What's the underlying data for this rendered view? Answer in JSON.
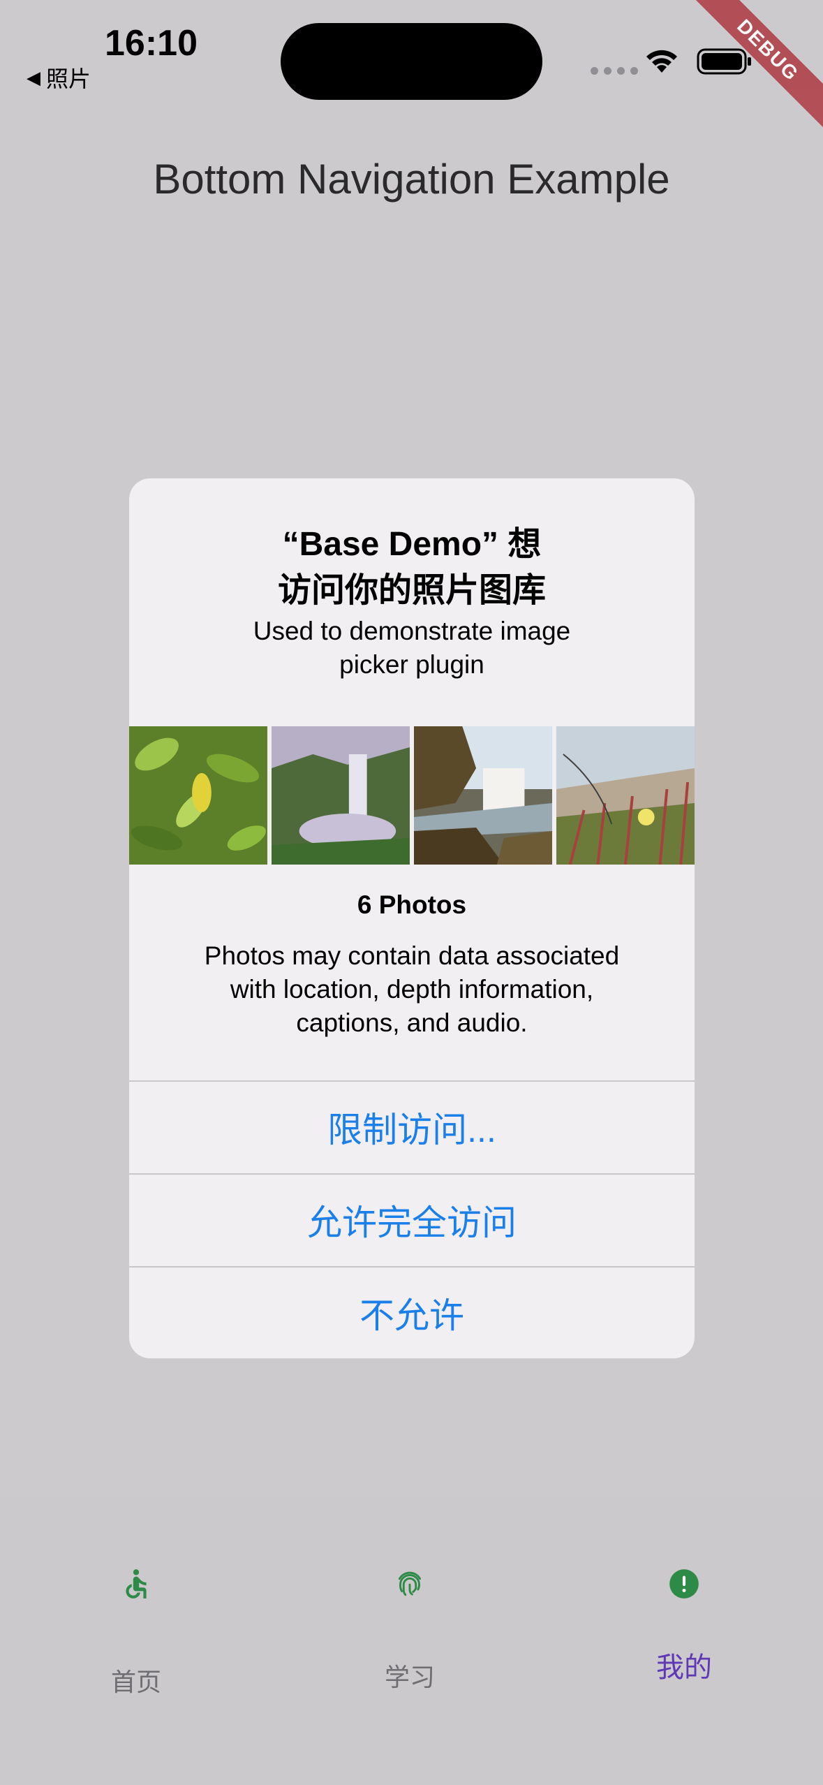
{
  "status_bar": {
    "time": "16:10",
    "back_label": "照片",
    "back_icon": "back-triangle-icon"
  },
  "debug_banner": "DEBUG",
  "app_bar": {
    "title": "Bottom Navigation Example"
  },
  "permission_alert": {
    "title_line1": "“Base Demo” 想",
    "title_line2": "访问你的照片图库",
    "message_line1": "Used to demonstrate image",
    "message_line2": "picker plugin",
    "photo_count": "6 Photos",
    "privacy_line1": "Photos may contain data associated",
    "privacy_line2": "with location, depth information,",
    "privacy_line3": "captions, and audio.",
    "buttons": {
      "limit": "限制访问...",
      "full": "允许完全访问",
      "deny": "不允许"
    }
  },
  "bottom_nav": {
    "items": [
      {
        "label": "首页",
        "icon": "accessible-icon",
        "selected": false
      },
      {
        "label": "学习",
        "icon": "fingerprint-icon",
        "selected": false
      },
      {
        "label": "我的",
        "icon": "error-icon",
        "selected": true
      }
    ],
    "colors": {
      "icon": "#2E8B47",
      "selected_label": "#5F38B5",
      "unselected_label": "#6E6E72"
    }
  },
  "colors": {
    "accent_button": "#1A7FE8",
    "dim_background": "#CCCACD",
    "alert_background": "#F1EFF2"
  }
}
